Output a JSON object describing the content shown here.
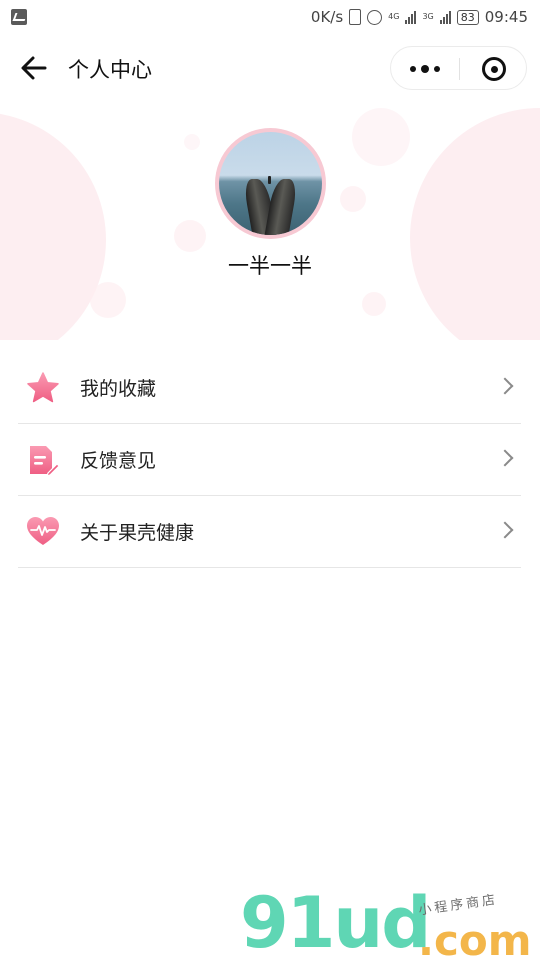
{
  "status_bar": {
    "net_speed": "0K/s",
    "network_4g": "4G",
    "network_3g": "3G",
    "battery": "83",
    "time": "09:45"
  },
  "nav": {
    "title": "个人中心",
    "back_icon": "arrow-left-icon",
    "more_icon": "more-dots-icon",
    "close_icon": "target-close-icon"
  },
  "profile": {
    "username": "一半一半",
    "avatar_icon": "avatar-photo"
  },
  "menu": {
    "items": [
      {
        "label": "我的收藏",
        "icon": "star-icon",
        "color": "#f57b98"
      },
      {
        "label": "反馈意见",
        "icon": "feedback-document-icon",
        "color": "#f57b98"
      },
      {
        "label": "关于果壳健康",
        "icon": "heart-pulse-icon",
        "color": "#f57b98"
      }
    ]
  },
  "colors": {
    "accent_pink": "#f57b98",
    "bubble_pink": "#fdeef1",
    "watermark_green": "#5fd6b4",
    "watermark_orange": "#f3b64a"
  },
  "watermark": {
    "main": "91ud",
    "sub": ".com",
    "script": "小程序商店"
  }
}
